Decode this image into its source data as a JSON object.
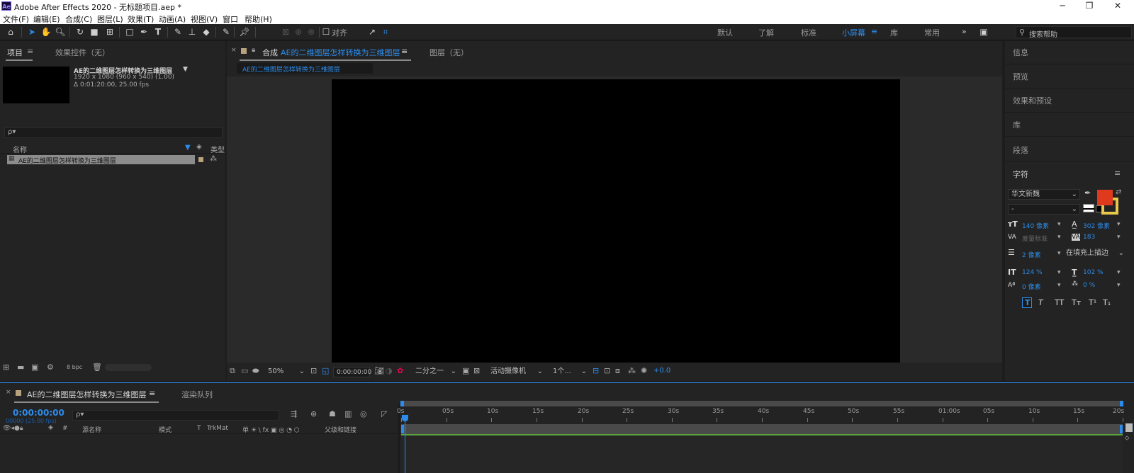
{
  "app": {
    "title": "Adobe After Effects 2020 - 无标题项目.aep *",
    "logo": "Ae"
  },
  "window_controls": {
    "minimize": "─",
    "restore": "❐",
    "close": "✕"
  },
  "menu": [
    "文件(F)",
    "编辑(E)",
    "合成(C)",
    "图层(L)",
    "效果(T)",
    "动画(A)",
    "视图(V)",
    "窗口",
    "帮助(H)"
  ],
  "toolbar": {
    "snap_label": "对齐",
    "workspaces": [
      "默认",
      "了解",
      "标准",
      "小屏幕",
      "库",
      "常用"
    ],
    "active_workspace": "小屏幕",
    "more": "»",
    "help_placeholder": "搜索帮助"
  },
  "project_panel": {
    "tab_project": "项目",
    "tab_effects": "效果控件（无）",
    "comp_name": "AE的二维图层怎样转换为三维图层",
    "comp_dims": "1920 x 1080  (960 x 540) (1.00)",
    "comp_duration": "Δ 0:01:20:00, 25.00 fps",
    "search_placeholder": "ρ▾",
    "col_name": "名称",
    "col_type": "类型",
    "item_name": "AE的二维图层怎样转换为三维图层",
    "bpc": "8 bpc"
  },
  "viewer": {
    "tab_comp_prefix": "合成",
    "tab_comp_name": "AE的二维图层怎样转换为三维图层",
    "tab_layer": "图层（无）",
    "breadcrumb": "AE的二维图层怎样转换为三维图层",
    "zoom": "50%",
    "timecode": "0:00:00:00",
    "resolution": "二分之一",
    "camera": "活动摄像机",
    "views": "1个...",
    "exposure": "+0.0"
  },
  "right_panel": {
    "items": [
      "信息",
      "预览",
      "效果和预设",
      "库",
      "段落"
    ],
    "character_title": "字符",
    "font": "华文新魏",
    "style": "-",
    "font_size": "140 像素",
    "leading": "302 像素",
    "kerning": "度量标准",
    "tracking": "183",
    "stroke_width": "2 像素",
    "stroke_mode": "在填充上描边",
    "vscale": "124 %",
    "hscale": "102 %",
    "baseline": "0 像素",
    "tsume": "0 %",
    "fill_color": "#e03a1e",
    "stroke_color": "#e8c84a",
    "style_buttons": [
      "T",
      "T",
      "TT",
      "Tт",
      "T¹",
      "T₁"
    ]
  },
  "timeline": {
    "tab_comp": "AE的二维图层怎样转换为三维图层",
    "tab_render": "渲染队列",
    "timecode": "0:00:00:00",
    "frame_info": "00000 (25.00 fps)",
    "search_placeholder": "ρ▾",
    "cols": {
      "num": "#",
      "source": "源名称",
      "mode": "模式",
      "t": "T",
      "trkmat": "TrkMat",
      "switches": "单 ☀ \\ fx ▣ ◎ ◔ ⬡",
      "parent": "父级和链接"
    },
    "ruler": [
      "0s",
      "05s",
      "10s",
      "15s",
      "20s",
      "25s",
      "30s",
      "35s",
      "40s",
      "45s",
      "50s",
      "55s",
      "01:00s",
      "05s",
      "10s",
      "15s",
      "20s"
    ]
  },
  "colors": {
    "accent": "#2d8ceb",
    "panel": "#232323",
    "bg": "#1d1d1d",
    "work_area": "#5aa63a"
  }
}
